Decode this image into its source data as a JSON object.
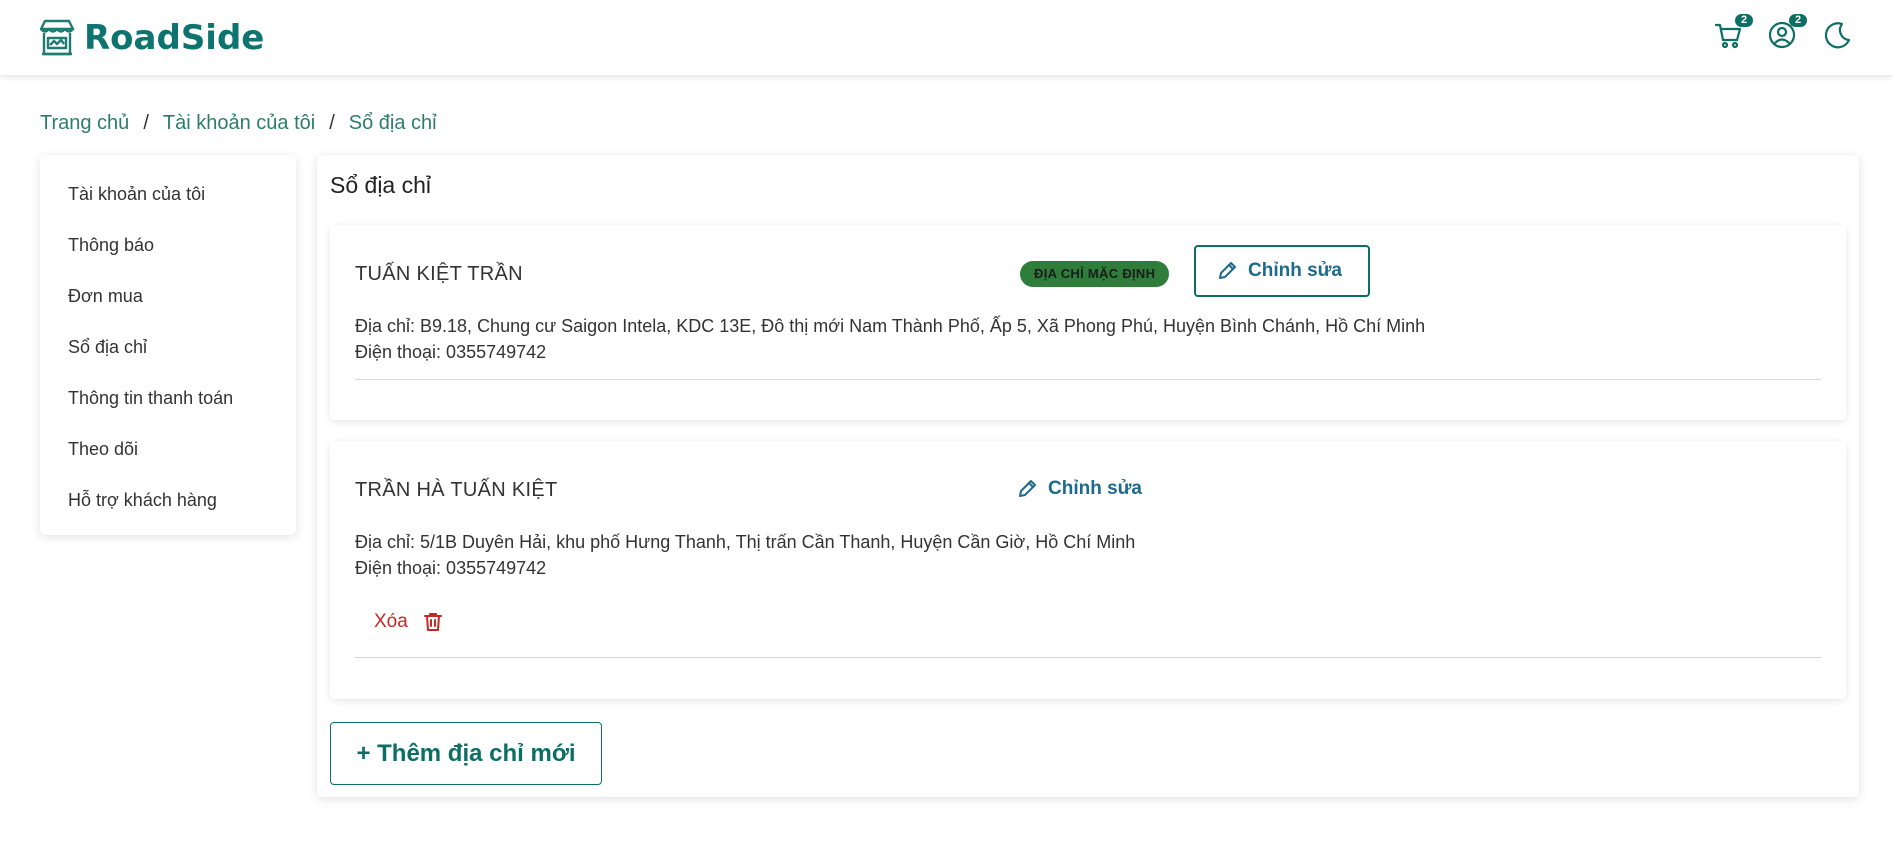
{
  "header": {
    "brand": "RoadSide",
    "cart_count": "2",
    "account_count": "2",
    "icons": [
      "store-logo-icon",
      "cart-icon",
      "account-icon",
      "moon-icon"
    ]
  },
  "breadcrumb": {
    "items": [
      "Trang chủ",
      "Tài khoản của tôi",
      "Sổ địa chỉ"
    ],
    "separator": "/"
  },
  "sidebar": {
    "items": [
      {
        "label": "Tài khoản của tôi"
      },
      {
        "label": "Thông báo"
      },
      {
        "label": "Đơn mua"
      },
      {
        "label": "Sổ địa chỉ"
      },
      {
        "label": "Thông tin thanh toán"
      },
      {
        "label": "Theo dõi"
      },
      {
        "label": "Hỗ trợ khách hàng"
      }
    ]
  },
  "main": {
    "title": "Sổ địa chỉ",
    "addresses": [
      {
        "name": "TUẤN KIỆT TRẦN",
        "default_badge": "ĐỊA CHỈ MẶC ĐỊNH",
        "edit_label": "Chỉnh sửa",
        "address": "Địa chỉ: B9.18, Chung cư Saigon Intela, KDC 13E, Đô thị mới Nam Thành Phố, Ấp 5, Xã Phong Phú, Huyện Bình Chánh, Hồ Chí Minh",
        "phone": "Điện thoại: 0355749742"
      },
      {
        "name": "TRẦN HÀ TUẤN KIỆT",
        "edit_label": "Chỉnh sửa",
        "address": "Địa chỉ: 5/1B Duyên Hải, khu phố Hưng Thanh, Thị trấn Cần Thanh, Huyện Cần Giờ, Hồ Chí Minh",
        "phone": "Điện thoại: 0355749742",
        "delete_label": "Xóa"
      }
    ],
    "add_button": "+ Thêm địa chỉ mới"
  },
  "colors": {
    "brand": "#0d7470",
    "link": "#2e7d6b",
    "edit": "#1e6a8c",
    "danger": "#c62828",
    "badge": "#2f7d3a"
  }
}
